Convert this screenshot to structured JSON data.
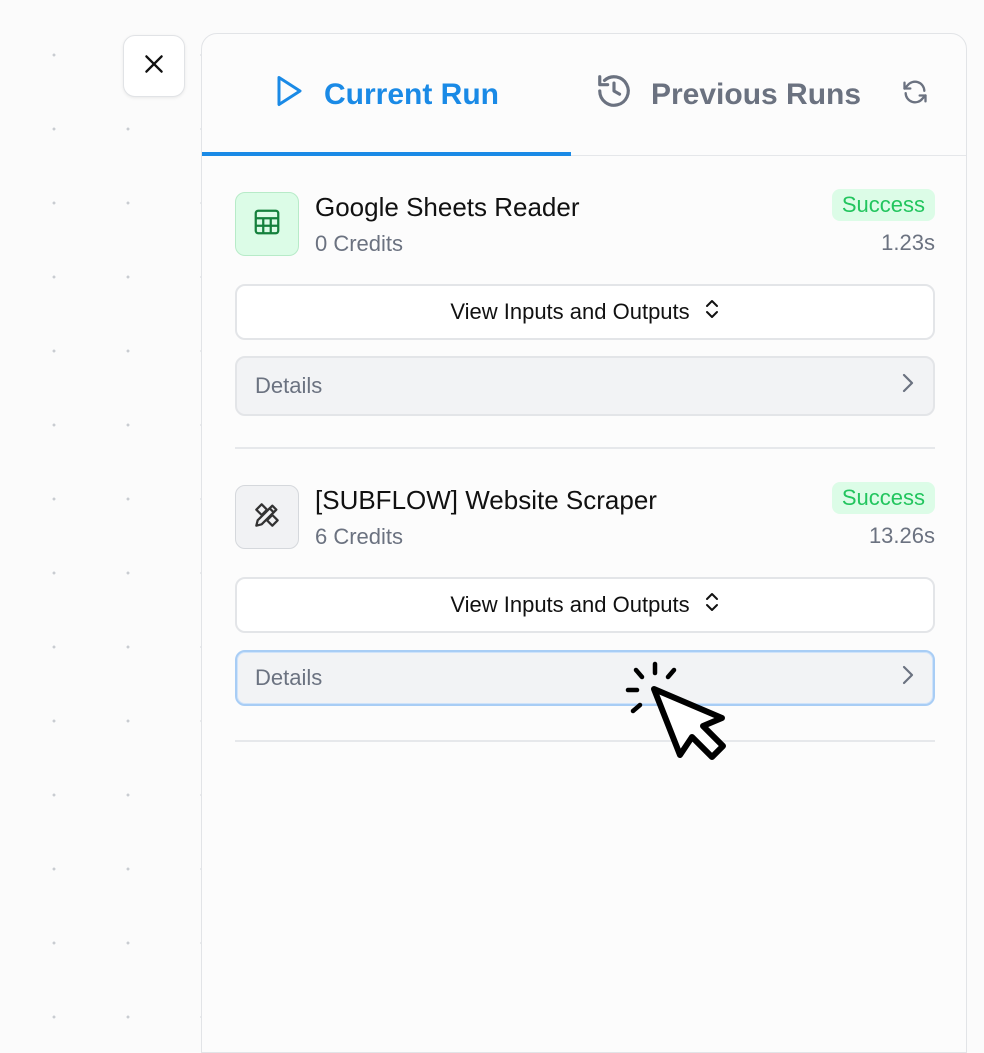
{
  "close_button": {
    "icon": "close-icon"
  },
  "tabs": [
    {
      "label": "Current Run",
      "icon": "play-icon",
      "active": true,
      "color": "#1a8ae6"
    },
    {
      "label": "Previous Runs",
      "icon": "history-icon",
      "active": false,
      "color": "#6b7280"
    }
  ],
  "refresh": {
    "icon": "refresh-icon"
  },
  "runs": [
    {
      "title": "Google Sheets Reader",
      "credits": "0 Credits",
      "status": "Success",
      "duration": "1.23s",
      "icon": "spreadsheet-icon",
      "io_label": "View Inputs and Outputs",
      "details_label": "Details"
    },
    {
      "title": "[SUBFLOW] Website Scraper",
      "credits": "6 Credits",
      "status": "Success",
      "duration": "13.26s",
      "icon": "tools-icon",
      "io_label": "View Inputs and Outputs",
      "details_label": "Details"
    }
  ],
  "colors": {
    "accent": "#1a8ae6",
    "success_text": "#22c55e",
    "success_bg": "#dcfce7"
  }
}
